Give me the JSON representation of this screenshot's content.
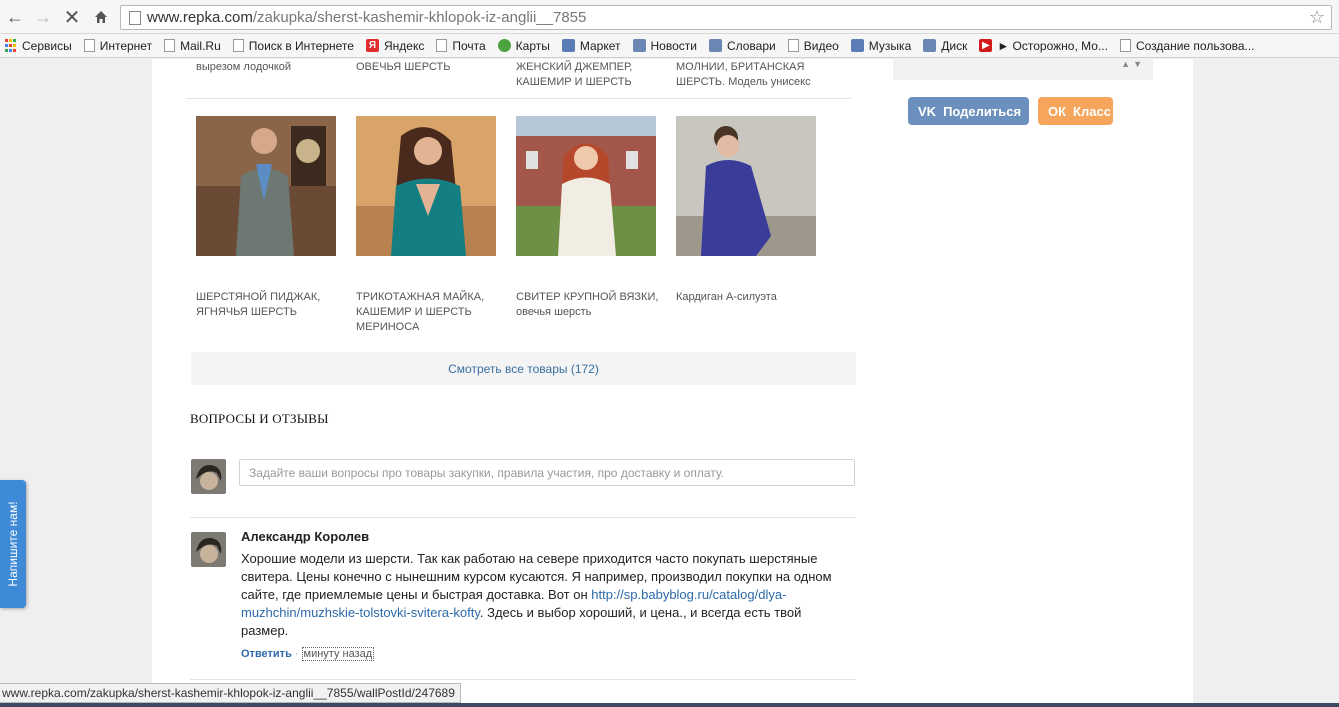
{
  "browser": {
    "url_host": "www.repka.com",
    "url_path": "/zakupka/sherst-kashemir-khlopok-iz-anglii__7855",
    "bookmarks": [
      {
        "label": "Сервисы",
        "icon": "apps-grid-icon"
      },
      {
        "label": "Интернет",
        "icon": "page-icon"
      },
      {
        "label": "Mail.Ru",
        "icon": "page-icon"
      },
      {
        "label": "Поиск в Интернете",
        "icon": "page-icon"
      },
      {
        "label": "Яндекс",
        "icon": "yandex-icon"
      },
      {
        "label": "Почта",
        "icon": "page-icon"
      },
      {
        "label": "Карты",
        "icon": "maps-icon"
      },
      {
        "label": "Маркет",
        "icon": "market-icon"
      },
      {
        "label": "Новости",
        "icon": "news-icon"
      },
      {
        "label": "Словари",
        "icon": "dictionaries-icon"
      },
      {
        "label": "Видео",
        "icon": "page-icon"
      },
      {
        "label": "Музыка",
        "icon": "music-icon"
      },
      {
        "label": "Диск",
        "icon": "disk-icon"
      },
      {
        "label": "► Осторожно, Мо...",
        "icon": "youtube-icon"
      },
      {
        "label": "Создание пользова...",
        "icon": "page-icon"
      }
    ]
  },
  "prev_row_captions": [
    "вырезом лодочкой",
    "ОВЕЧЬЯ ШЕРСТЬ",
    "ЖЕНСКИЙ ДЖЕМПЕР, КАШЕМИР И ШЕРСТЬ",
    "МОЛНИИ, БРИТАНСКАЯ ШЕРСТЬ. Модель унисекс"
  ],
  "products": [
    {
      "caption": "ШЕРСТЯНОЙ ПИДЖАК, ЯГНЯЧЬЯ ШЕРСТЬ"
    },
    {
      "caption": "ТРИКОТАЖНАЯ МАЙКА, КАШЕМИР И ШЕРСТЬ МЕРИНОСА"
    },
    {
      "caption": "СВИТЕР КРУПНОЙ ВЯЗКИ, овечья шерсть"
    },
    {
      "caption": "Кардиган А-силуэта"
    }
  ],
  "see_all_label": "Смотреть все товары (172)",
  "reviews": {
    "title": "ВОПРОСЫ И ОТЗЫВЫ",
    "input_placeholder": "Задайте ваши вопросы про товары закупки, правила участия, про доставку и оплату.",
    "comment": {
      "author": "Александр Королев",
      "text_before": "Хорошие модели из шерсти. Так как работаю на севере приходится часто покупать шерстяные свитера. Цены конечно с нынешним курсом кусаются. Я например, производил покупки на одном сайте, где приемлемые цены и быстрая доставка. Вот он ",
      "link": "http://sp.babyblog.ru/catalog/dlya-muzhchin/muzhskie-tolstovki-svitera-kofty",
      "text_after": ". Здесь и выбор хороший, и цена., и всегда есть твой размер.",
      "reply_label": "Ответить",
      "separator": "·",
      "time": "минуту назад"
    }
  },
  "share": {
    "vk_logo": "VK",
    "vk_label": "Поделиться",
    "ok_logo": "ОК",
    "ok_label": "Класс"
  },
  "feedback_label": "Напишите нам!",
  "status_url": "www.repka.com/zakupka/sherst-kashemir-khlopok-iz-anglii__7855/wallPostId/247689",
  "colors": {
    "link": "#2c6aa8",
    "vk": "#6c90bd",
    "ok": "#f5a55c",
    "feedback": "#3e8ad6"
  }
}
